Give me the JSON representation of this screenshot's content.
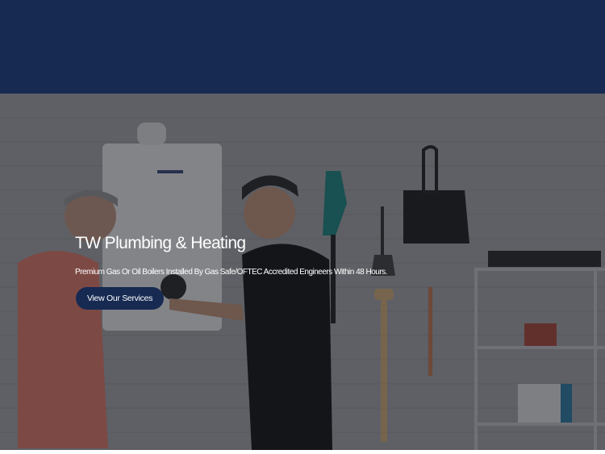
{
  "colors": {
    "brand_navy": "#172a52",
    "text_light": "#ffffff",
    "overlay": "rgba(20,22,30,0.5)"
  },
  "hero": {
    "title": "TW Plumbing & Heating",
    "subtitle": "Premium Gas Or Oil Boilers Installed By Gas Safe/OFTEC Accredited Engineers Within 48 Hours.",
    "cta_label": "View Our Services",
    "background_image": "boiler-installation-photo"
  }
}
